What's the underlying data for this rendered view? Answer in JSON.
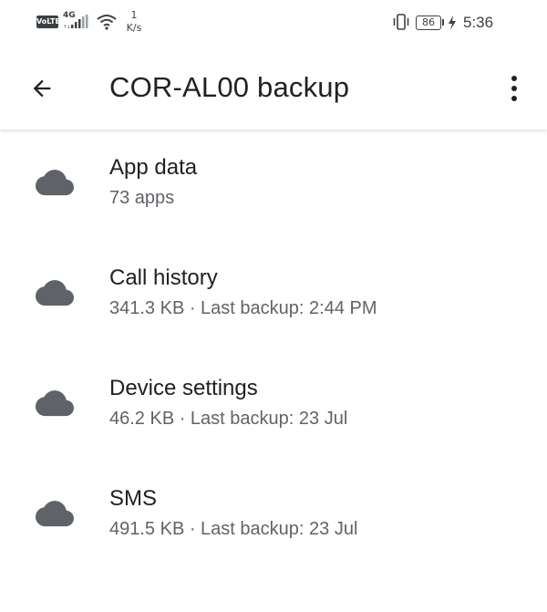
{
  "status_bar": {
    "volte": "VoLTE",
    "network_type": "4G",
    "speed_value": "1",
    "speed_unit": "K/s",
    "battery": "86",
    "time": "5:36"
  },
  "app_bar": {
    "title": "COR-AL00 backup"
  },
  "items": [
    {
      "title": "App data",
      "subtitle": "73 apps"
    },
    {
      "title": "Call history",
      "subtitle": "341.3 KB · Last backup: 2:44 PM"
    },
    {
      "title": "Device settings",
      "subtitle": "46.2 KB · Last backup: 23 Jul"
    },
    {
      "title": "SMS",
      "subtitle": "491.5 KB · Last backup: 23 Jul"
    }
  ],
  "icons": {
    "back": "arrow-back-icon",
    "menu": "more-vert-icon",
    "item": "cloud-icon"
  },
  "colors": {
    "icon": "#5f6368",
    "title_text": "#202124",
    "subtitle_text": "#5f6368",
    "background": "#ffffff"
  }
}
